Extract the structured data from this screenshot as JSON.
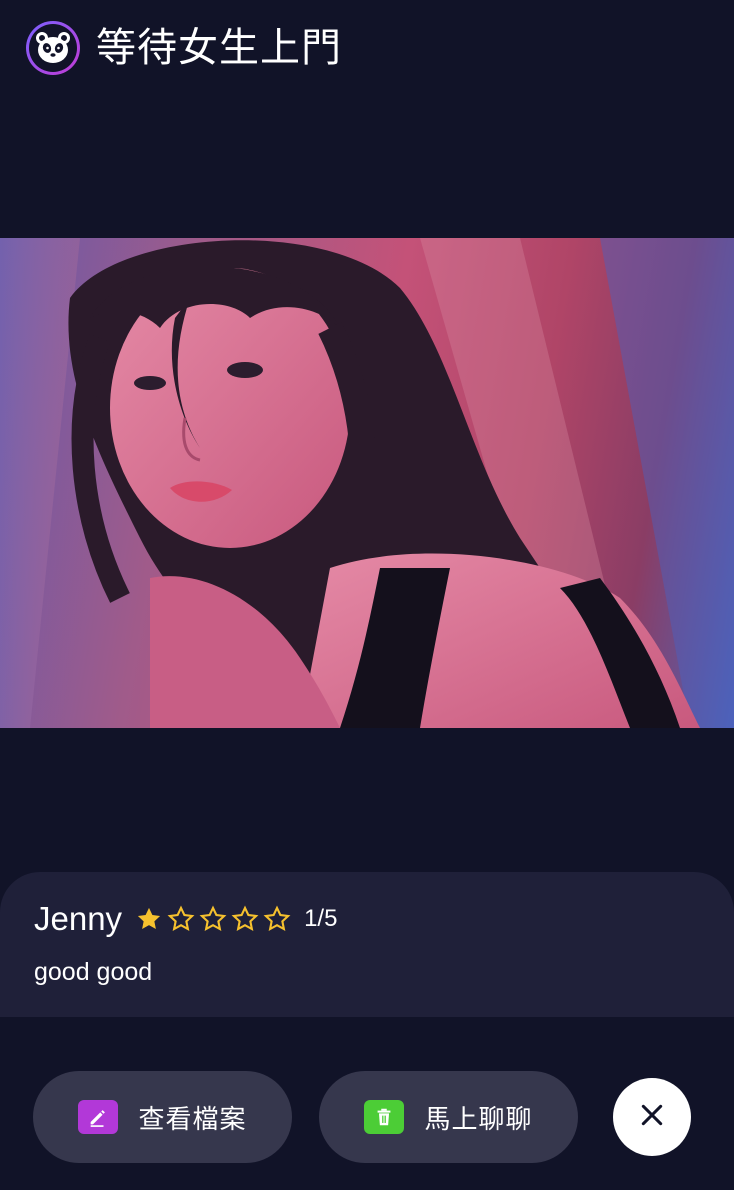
{
  "header": {
    "logo_icon": "panda-icon",
    "title": "等待女生上門"
  },
  "photo": {
    "subject": "profile-photo"
  },
  "profile": {
    "name": "Jenny",
    "rating": 1,
    "rating_max": 5,
    "rating_text": "1/5",
    "description": "good good",
    "star_color": "#f6c12e"
  },
  "actions": {
    "view_profile": {
      "label": "查看檔案",
      "icon": "edit-icon",
      "icon_color": "#b238d8"
    },
    "chat_now": {
      "label": "馬上聊聊",
      "icon": "trash-icon",
      "icon_color": "#4ccd36"
    },
    "close": {
      "icon": "close-icon"
    }
  }
}
